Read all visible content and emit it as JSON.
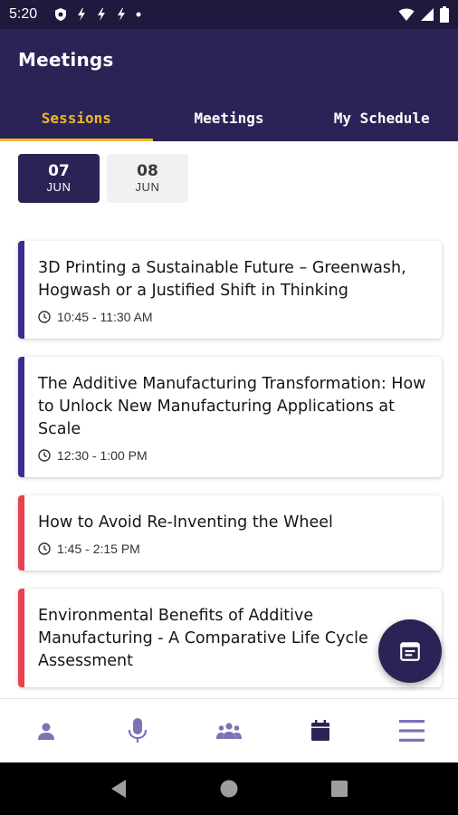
{
  "status_bar": {
    "time": "5:20",
    "icons": [
      "shield-icon",
      "flash-icon",
      "flash-icon",
      "flash-icon",
      "dot-icon",
      "wifi-icon",
      "signal-icon",
      "battery-icon"
    ]
  },
  "header": {
    "title": "Meetings",
    "tabs": [
      {
        "label": "Sessions",
        "active": true
      },
      {
        "label": "Meetings",
        "active": false
      },
      {
        "label": "My Schedule",
        "active": false
      }
    ]
  },
  "dates": [
    {
      "day": "07",
      "month": "JUN",
      "active": true
    },
    {
      "day": "08",
      "month": "JUN",
      "active": false
    }
  ],
  "sessions": [
    {
      "title": "3D Printing a Sustainable Future – Greenwash, Hogwash or a Justified Shift in Thinking",
      "time": "10:45 - 11:30 AM",
      "color": "#3d2d8c"
    },
    {
      "title": "The Additive Manufacturing Transformation: How to Unlock New Manufacturing Applications at Scale",
      "time": "12:30 - 1:00 PM",
      "color": "#3d2d8c"
    },
    {
      "title": "How to Avoid Re-Inventing the Wheel",
      "time": "1:45 - 2:15 PM",
      "color": "#e8414f"
    },
    {
      "title": "Environmental Benefits of Additive Manufacturing - A Comparative Life Cycle Assessment",
      "time": "",
      "color": "#e8414f"
    }
  ],
  "fab": {
    "icon": "calendar-icon"
  },
  "bottom_nav": {
    "items": [
      "person-icon",
      "microphone-icon",
      "group-icon",
      "calendar-icon",
      "menu-icon"
    ],
    "active_index": 3
  },
  "system_nav": [
    "back-icon",
    "home-icon",
    "recents-icon"
  ],
  "colors": {
    "header_bg": "#2a2456",
    "accent": "#f1b62c",
    "status_bg": "#1e1a3d",
    "nav_icon": "#7d72b5",
    "nav_icon_active": "#2a2456"
  }
}
